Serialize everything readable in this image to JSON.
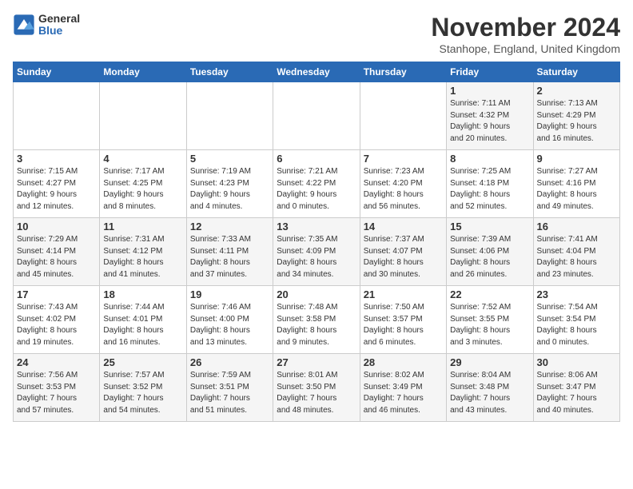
{
  "logo": {
    "general": "General",
    "blue": "Blue"
  },
  "title": "November 2024",
  "location": "Stanhope, England, United Kingdom",
  "days_of_week": [
    "Sunday",
    "Monday",
    "Tuesday",
    "Wednesday",
    "Thursday",
    "Friday",
    "Saturday"
  ],
  "weeks": [
    [
      {
        "day": "",
        "info": ""
      },
      {
        "day": "",
        "info": ""
      },
      {
        "day": "",
        "info": ""
      },
      {
        "day": "",
        "info": ""
      },
      {
        "day": "",
        "info": ""
      },
      {
        "day": "1",
        "info": "Sunrise: 7:11 AM\nSunset: 4:32 PM\nDaylight: 9 hours\nand 20 minutes."
      },
      {
        "day": "2",
        "info": "Sunrise: 7:13 AM\nSunset: 4:29 PM\nDaylight: 9 hours\nand 16 minutes."
      }
    ],
    [
      {
        "day": "3",
        "info": "Sunrise: 7:15 AM\nSunset: 4:27 PM\nDaylight: 9 hours\nand 12 minutes."
      },
      {
        "day": "4",
        "info": "Sunrise: 7:17 AM\nSunset: 4:25 PM\nDaylight: 9 hours\nand 8 minutes."
      },
      {
        "day": "5",
        "info": "Sunrise: 7:19 AM\nSunset: 4:23 PM\nDaylight: 9 hours\nand 4 minutes."
      },
      {
        "day": "6",
        "info": "Sunrise: 7:21 AM\nSunset: 4:22 PM\nDaylight: 9 hours\nand 0 minutes."
      },
      {
        "day": "7",
        "info": "Sunrise: 7:23 AM\nSunset: 4:20 PM\nDaylight: 8 hours\nand 56 minutes."
      },
      {
        "day": "8",
        "info": "Sunrise: 7:25 AM\nSunset: 4:18 PM\nDaylight: 8 hours\nand 52 minutes."
      },
      {
        "day": "9",
        "info": "Sunrise: 7:27 AM\nSunset: 4:16 PM\nDaylight: 8 hours\nand 49 minutes."
      }
    ],
    [
      {
        "day": "10",
        "info": "Sunrise: 7:29 AM\nSunset: 4:14 PM\nDaylight: 8 hours\nand 45 minutes."
      },
      {
        "day": "11",
        "info": "Sunrise: 7:31 AM\nSunset: 4:12 PM\nDaylight: 8 hours\nand 41 minutes."
      },
      {
        "day": "12",
        "info": "Sunrise: 7:33 AM\nSunset: 4:11 PM\nDaylight: 8 hours\nand 37 minutes."
      },
      {
        "day": "13",
        "info": "Sunrise: 7:35 AM\nSunset: 4:09 PM\nDaylight: 8 hours\nand 34 minutes."
      },
      {
        "day": "14",
        "info": "Sunrise: 7:37 AM\nSunset: 4:07 PM\nDaylight: 8 hours\nand 30 minutes."
      },
      {
        "day": "15",
        "info": "Sunrise: 7:39 AM\nSunset: 4:06 PM\nDaylight: 8 hours\nand 26 minutes."
      },
      {
        "day": "16",
        "info": "Sunrise: 7:41 AM\nSunset: 4:04 PM\nDaylight: 8 hours\nand 23 minutes."
      }
    ],
    [
      {
        "day": "17",
        "info": "Sunrise: 7:43 AM\nSunset: 4:02 PM\nDaylight: 8 hours\nand 19 minutes."
      },
      {
        "day": "18",
        "info": "Sunrise: 7:44 AM\nSunset: 4:01 PM\nDaylight: 8 hours\nand 16 minutes."
      },
      {
        "day": "19",
        "info": "Sunrise: 7:46 AM\nSunset: 4:00 PM\nDaylight: 8 hours\nand 13 minutes."
      },
      {
        "day": "20",
        "info": "Sunrise: 7:48 AM\nSunset: 3:58 PM\nDaylight: 8 hours\nand 9 minutes."
      },
      {
        "day": "21",
        "info": "Sunrise: 7:50 AM\nSunset: 3:57 PM\nDaylight: 8 hours\nand 6 minutes."
      },
      {
        "day": "22",
        "info": "Sunrise: 7:52 AM\nSunset: 3:55 PM\nDaylight: 8 hours\nand 3 minutes."
      },
      {
        "day": "23",
        "info": "Sunrise: 7:54 AM\nSunset: 3:54 PM\nDaylight: 8 hours\nand 0 minutes."
      }
    ],
    [
      {
        "day": "24",
        "info": "Sunrise: 7:56 AM\nSunset: 3:53 PM\nDaylight: 7 hours\nand 57 minutes."
      },
      {
        "day": "25",
        "info": "Sunrise: 7:57 AM\nSunset: 3:52 PM\nDaylight: 7 hours\nand 54 minutes."
      },
      {
        "day": "26",
        "info": "Sunrise: 7:59 AM\nSunset: 3:51 PM\nDaylight: 7 hours\nand 51 minutes."
      },
      {
        "day": "27",
        "info": "Sunrise: 8:01 AM\nSunset: 3:50 PM\nDaylight: 7 hours\nand 48 minutes."
      },
      {
        "day": "28",
        "info": "Sunrise: 8:02 AM\nSunset: 3:49 PM\nDaylight: 7 hours\nand 46 minutes."
      },
      {
        "day": "29",
        "info": "Sunrise: 8:04 AM\nSunset: 3:48 PM\nDaylight: 7 hours\nand 43 minutes."
      },
      {
        "day": "30",
        "info": "Sunrise: 8:06 AM\nSunset: 3:47 PM\nDaylight: 7 hours\nand 40 minutes."
      }
    ]
  ]
}
